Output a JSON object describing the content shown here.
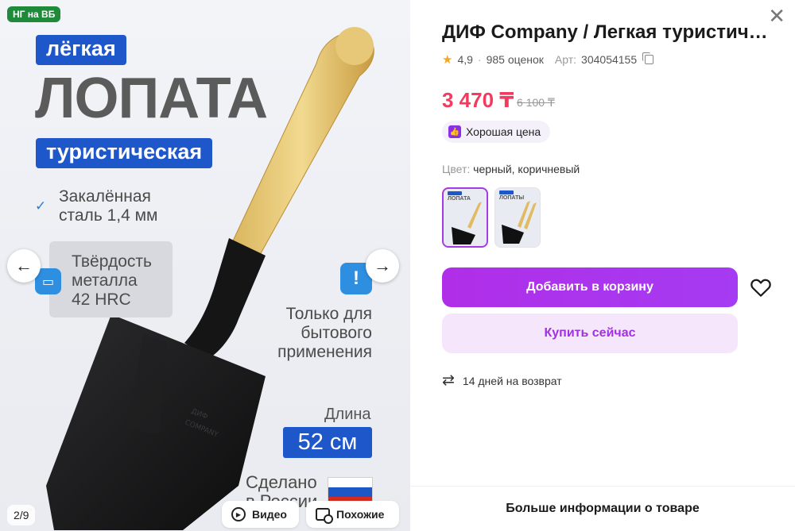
{
  "gallery": {
    "promo_badge": "НГ на ВБ",
    "slide": {
      "tag_light": "лёгкая",
      "big_title": "ЛОПАТА",
      "tag_tourist": "туристическая",
      "feature_steel": [
        "Закалённая",
        "сталь 1,4 мм"
      ],
      "feature_hardness": [
        "Твёрдость",
        "металла",
        "42 HRC"
      ],
      "feature_home": [
        "Только для",
        "бытового",
        "применения"
      ],
      "length_label": "Длина",
      "length_value": "52 см",
      "made_in": [
        "Сделано",
        "в России"
      ],
      "engraving": [
        "ДИФ",
        "COMPANY"
      ]
    },
    "counter": "2/9",
    "video_label": "Видео",
    "similar_label": "Похожие"
  },
  "product": {
    "title": "ДИФ Company / Легкая туристическая лопата",
    "rating": "4,9",
    "reviews": "985 оценок",
    "article_label": "Арт:",
    "article_number": "304054155",
    "price": "3 470 ₸",
    "old_price": "6 100 ₸",
    "good_price_label": "Хорошая цена",
    "color_label": "Цвет:",
    "color_value": "черный, коричневый",
    "variants": [
      {
        "title": "ЛОПАТА"
      },
      {
        "title": "ЛОПАТЫ"
      }
    ],
    "add_to_cart": "Добавить в корзину",
    "buy_now": "Купить сейчас",
    "return_policy": "14 дней на возврат",
    "more_info": "Больше информации о товаре"
  },
  "colors": {
    "accent": "#a53bf2",
    "price": "#f13b5f",
    "tag_blue": "#1e57c9",
    "promo_green": "#1f8a3a"
  },
  "icons": [
    "arrow-left-icon",
    "arrow-right-icon",
    "close-icon",
    "star-icon",
    "copy-icon",
    "thumb-up-icon",
    "heart-icon",
    "return-icon",
    "play-icon",
    "similar-icon",
    "check-icon",
    "hardness-icon",
    "warning-icon"
  ]
}
